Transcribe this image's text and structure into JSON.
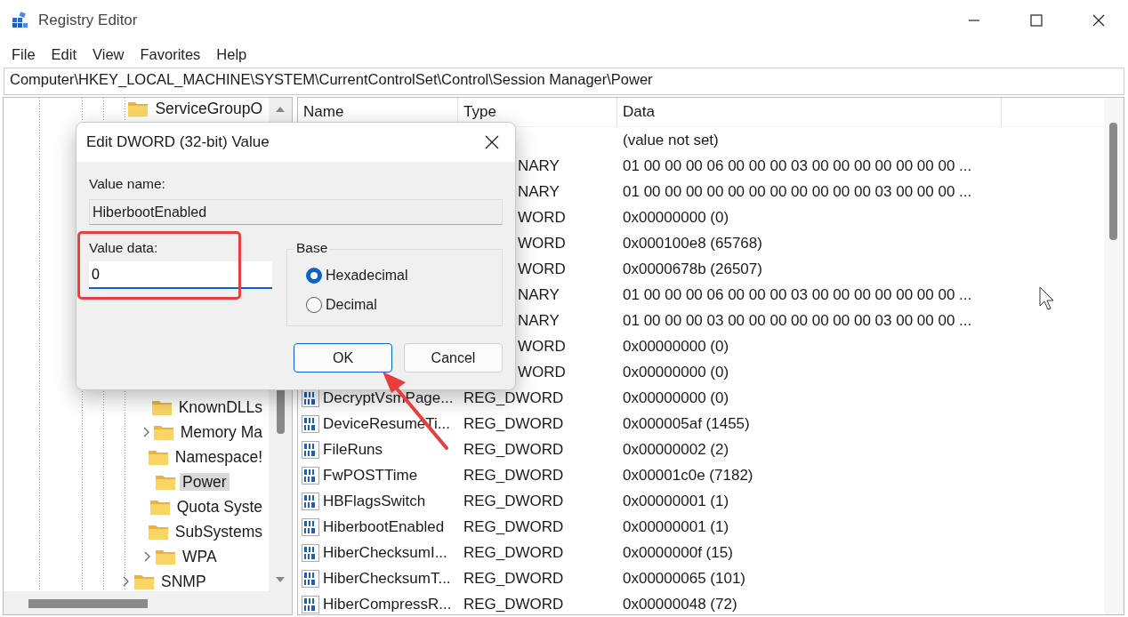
{
  "window": {
    "title": "Registry Editor"
  },
  "menu": [
    "File",
    "Edit",
    "View",
    "Favorites",
    "Help"
  ],
  "address": "Computer\\HKEY_LOCAL_MACHINE\\SYSTEM\\CurrentControlSet\\Control\\Session Manager\\Power",
  "tree": [
    {
      "label": "ServiceGroupO",
      "expandable": false,
      "selected": false
    },
    {
      "children": [
        {
          "label": "KnownDLLs",
          "expandable": false,
          "selected": false
        },
        {
          "label": "Memory Ma",
          "expandable": true,
          "selected": false
        },
        {
          "label": "Namespace!",
          "expandable": false,
          "selected": false
        },
        {
          "label": "Power",
          "expandable": false,
          "selected": true
        },
        {
          "label": "Quota Syste",
          "expandable": false,
          "selected": false
        },
        {
          "label": "SubSystems",
          "expandable": false,
          "selected": false
        },
        {
          "label": "WPA",
          "expandable": true,
          "selected": false
        }
      ]
    },
    {
      "label": "SNMP",
      "expandable": true,
      "selected": false
    }
  ],
  "table": {
    "columns": [
      "Name",
      "Type",
      "Data"
    ],
    "rows": [
      {
        "data": "(value not set)"
      },
      {
        "type": "NARY",
        "data": "01 00 00 00 06 00 00 00 03 00 00 00 00 00 00 00 ..."
      },
      {
        "type": "NARY",
        "data": "01 00 00 00 00 00 00 00 00 00 00 00 03 00 00 00 ..."
      },
      {
        "type": "WORD",
        "data": "0x00000000 (0)"
      },
      {
        "type": "WORD",
        "data": "0x000100e8 (65768)"
      },
      {
        "type": "WORD",
        "data": "0x0000678b (26507)"
      },
      {
        "type": "NARY",
        "data": "01 00 00 00 06 00 00 00 03 00 00 00 00 00 00 00 ..."
      },
      {
        "type": "NARY",
        "data": "01 00 00 00 03 00 00 00 00 00 00 00 03 00 00 00 ..."
      },
      {
        "type": "WORD",
        "data": "0x00000000 (0)"
      },
      {
        "type": "WORD",
        "data": "0x00000000 (0)"
      },
      {
        "name": "DecryptVsmPage...",
        "type": "REG_DWORD",
        "data": "0x00000000 (0)"
      },
      {
        "name": "DeviceResumeTi...",
        "type": "REG_DWORD",
        "data": "0x000005af (1455)"
      },
      {
        "name": "FileRuns",
        "type": "REG_DWORD",
        "data": "0x00000002 (2)"
      },
      {
        "name": "FwPOSTTime",
        "type": "REG_DWORD",
        "data": "0x00001c0e (7182)"
      },
      {
        "name": "HBFlagsSwitch",
        "type": "REG_DWORD",
        "data": "0x00000001 (1)"
      },
      {
        "name": "HiberbootEnabled",
        "type": "REG_DWORD",
        "data": "0x00000001 (1)"
      },
      {
        "name": "HiberChecksumI...",
        "type": "REG_DWORD",
        "data": "0x0000000f (15)"
      },
      {
        "name": "HiberChecksumT...",
        "type": "REG_DWORD",
        "data": "0x00000065 (101)"
      },
      {
        "name": "HiberCompressR...",
        "type": "REG_DWORD",
        "data": "0x00000048 (72)"
      }
    ]
  },
  "dialog": {
    "title": "Edit DWORD (32-bit) Value",
    "name_label": "Value name:",
    "name_value": "HiberbootEnabled",
    "data_label": "Value data:",
    "data_value": "0",
    "base_label": "Base",
    "bases": [
      {
        "label": "Hexadecimal",
        "selected": true
      },
      {
        "label": "Decimal",
        "selected": false
      }
    ],
    "buttons": [
      {
        "label": "OK",
        "default": true
      },
      {
        "label": "Cancel",
        "default": false
      }
    ]
  }
}
